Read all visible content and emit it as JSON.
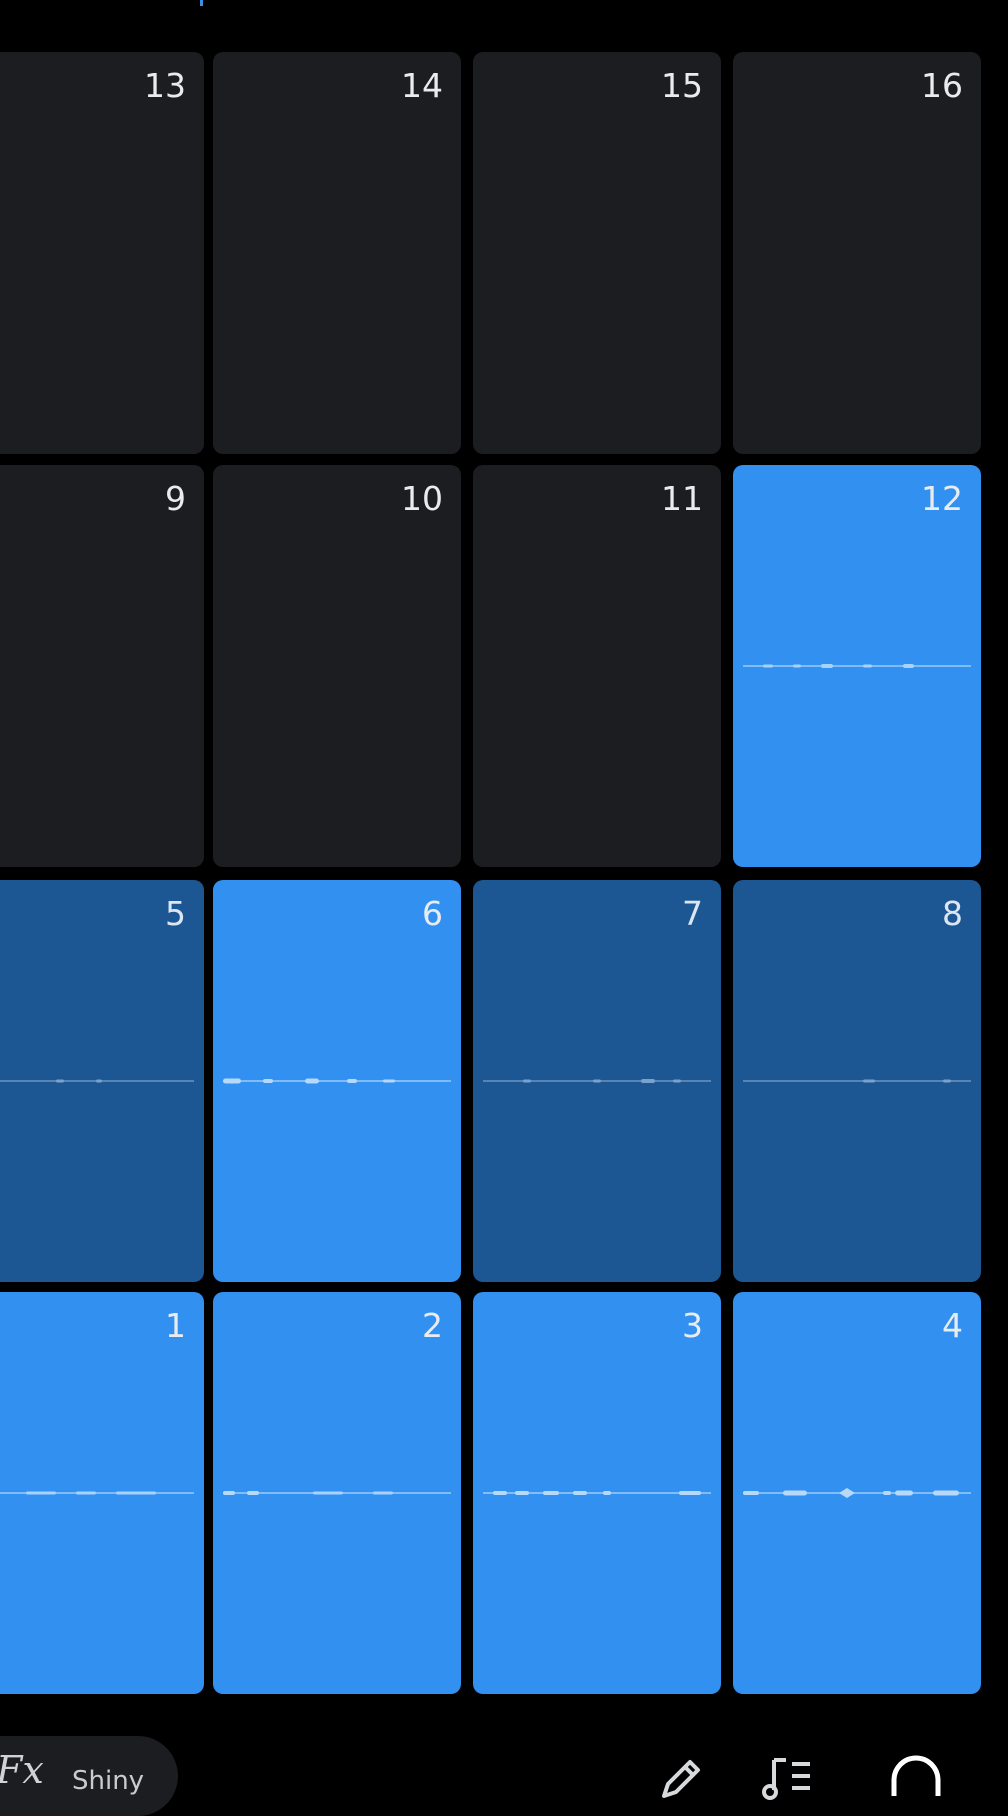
{
  "pads": [
    {
      "number": "13",
      "state": "empty"
    },
    {
      "number": "14",
      "state": "empty"
    },
    {
      "number": "15",
      "state": "empty"
    },
    {
      "number": "16",
      "state": "empty"
    },
    {
      "number": "9",
      "state": "empty"
    },
    {
      "number": "10",
      "state": "empty"
    },
    {
      "number": "11",
      "state": "empty"
    },
    {
      "number": "12",
      "state": "active"
    },
    {
      "number": "5",
      "state": "dim"
    },
    {
      "number": "6",
      "state": "active"
    },
    {
      "number": "7",
      "state": "dim"
    },
    {
      "number": "8",
      "state": "dim"
    },
    {
      "number": "1",
      "state": "active"
    },
    {
      "number": "2",
      "state": "active"
    },
    {
      "number": "3",
      "state": "active"
    },
    {
      "number": "4",
      "state": "active"
    }
  ],
  "bottom_bar": {
    "fx_icon_text": "Fx",
    "preset_label": "Shiny",
    "icons": [
      "pencil-icon",
      "music-note-list-icon",
      "headphones-icon"
    ]
  },
  "colors": {
    "active_pad": "#3190f0",
    "dim_pad": "#1d5793",
    "empty_pad": "#1c1d20",
    "background": "#000000"
  }
}
